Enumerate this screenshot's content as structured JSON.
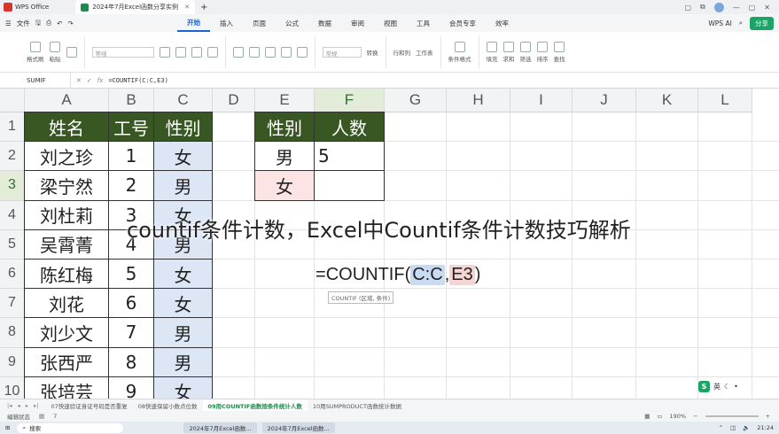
{
  "titlebar": {
    "app": "WPS Office",
    "doc_tab": "2024年7月Excel函数分享实例"
  },
  "menubar": {
    "file": "文件",
    "tabs": [
      "开始",
      "插入",
      "页面",
      "公式",
      "数据",
      "审阅",
      "视图",
      "工具",
      "会员专享",
      "效率"
    ],
    "active_tab": "开始",
    "wps_ai": "WPS AI",
    "share": "分享"
  },
  "ribbon": {
    "format_painter": "格式刷",
    "paste": "粘贴",
    "font_name": "等线",
    "number_format": "常规",
    "convert": "转换",
    "rows_cols": "行和列",
    "worksheet": "工作表",
    "cond_format": "条件格式",
    "fill": "填充",
    "sum": "求和",
    "filter": "筛选",
    "sort": "排序",
    "find": "查找"
  },
  "formulabar": {
    "name_box": "SUMIF",
    "formula": "=COUNTIF(C:C,E3)"
  },
  "grid": {
    "columns": [
      "A",
      "B",
      "C",
      "D",
      "E",
      "F",
      "G",
      "H",
      "I",
      "J",
      "K",
      "L"
    ],
    "rows": [
      "1",
      "2",
      "3",
      "4",
      "5",
      "6",
      "7",
      "8",
      "9",
      "10"
    ],
    "table1": {
      "headers": [
        "姓名",
        "工号",
        "性别"
      ],
      "rows": [
        [
          "刘之珍",
          "1",
          "女"
        ],
        [
          "梁宁然",
          "2",
          "男"
        ],
        [
          "刘杜莉",
          "3",
          "女"
        ],
        [
          "吴霄菁",
          "4",
          "男"
        ],
        [
          "陈红梅",
          "5",
          "女"
        ],
        [
          "刘花",
          "6",
          "女"
        ],
        [
          "刘少文",
          "7",
          "男"
        ],
        [
          "张西严",
          "8",
          "男"
        ],
        [
          "张培芸",
          "9",
          "女"
        ]
      ]
    },
    "table2": {
      "headers": [
        "性别",
        "人数"
      ],
      "rows": [
        [
          "男",
          "5"
        ],
        [
          "女",
          ""
        ]
      ]
    },
    "formula_parts": {
      "eq": "=",
      "fn": "COUNTIF(",
      "arg1": "C:C",
      "comma": ",",
      "arg2": "E3",
      "close": ")"
    },
    "tooltip": "COUNTIF (区域, 条件)"
  },
  "overlay_caption": "countif条件计数，Excel中Countif条件计数技巧解析",
  "sheet_tabs": [
    "07快速验证身证号码是否重复",
    "08快速保留小数点位数",
    "09用COUNTIF函数按条件统计人数",
    "10用SUMPRODUCT函数统计数据"
  ],
  "active_sheet_index": 2,
  "statusbar": {
    "mode": "编辑状态",
    "count": "7",
    "zoom": "190%"
  },
  "ime": {
    "lang": "英"
  },
  "taskbar": {
    "search": "搜索",
    "items": [
      "2024年7月Excel函数...",
      "2024年7月Excel函数..."
    ],
    "time": "21:24"
  }
}
